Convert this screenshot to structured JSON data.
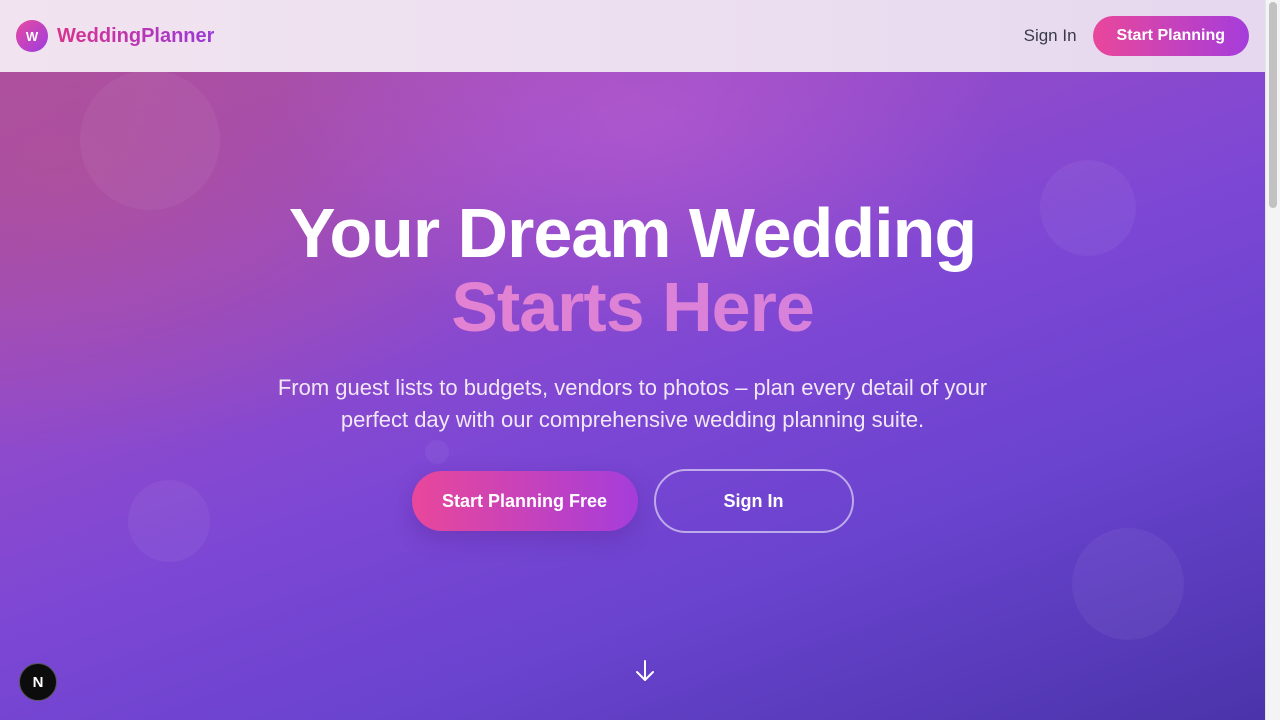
{
  "header": {
    "logo_letter": "W",
    "brand_name": "WeddingPlanner",
    "signin_label": "Sign In",
    "start_label": "Start Planning"
  },
  "hero": {
    "headline_line1": "Your Dream Wedding",
    "headline_line2": "Starts Here",
    "subtitle": "From guest lists to budgets, vendors to photos – plan every detail of your perfect day with our comprehensive wedding planning suite.",
    "primary_cta": "Start Planning Free",
    "secondary_cta": "Sign In"
  },
  "icons": {
    "logo": "wedding-logo-icon",
    "scroll": "arrow-down-icon",
    "dev_badge": "nextjs-icon"
  },
  "dev_badge_letter": "N",
  "colors": {
    "accent_pink": "#e9479a",
    "accent_purple": "#a53ddb",
    "hero_gradient_start": "#b0509a",
    "hero_gradient_end": "#4a34aa"
  }
}
